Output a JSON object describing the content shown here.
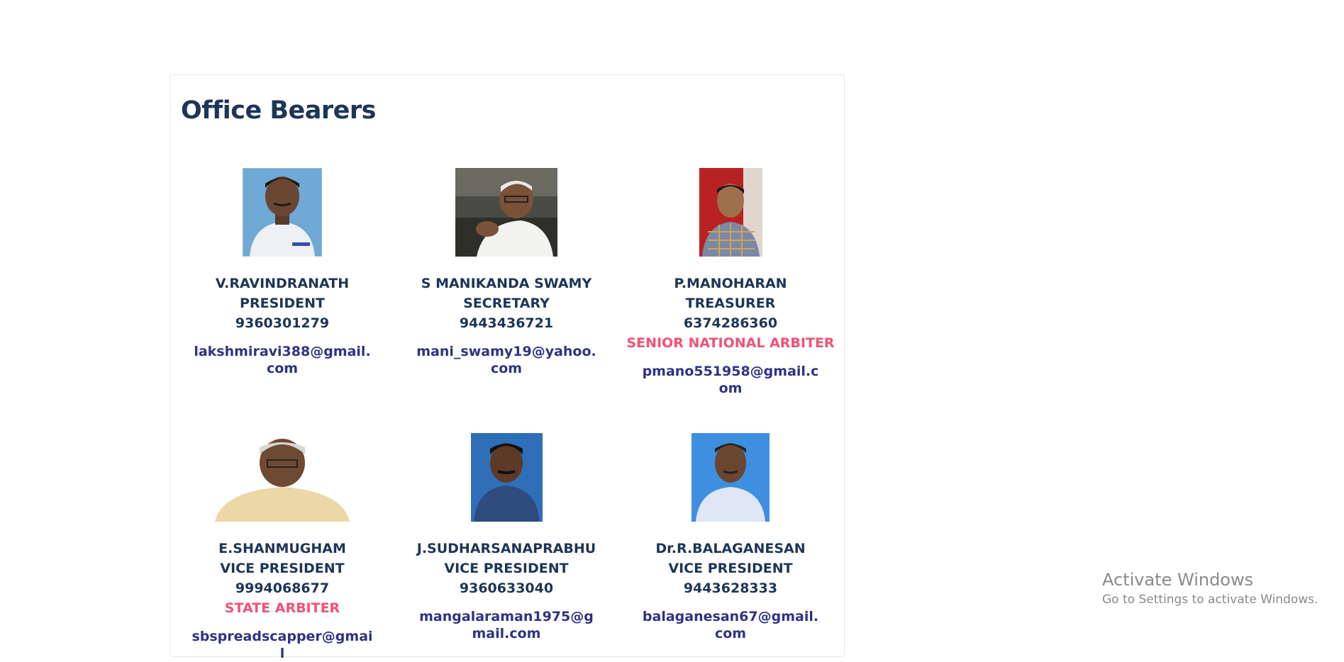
{
  "section": {
    "title": "Office Bearers"
  },
  "members": [
    {
      "name": "V.RAVINDRANATH",
      "role": "PRESIDENT",
      "phone": "9360301279",
      "title_badge": "",
      "email": "lakshmiravi388@gmail.com"
    },
    {
      "name": "S MANIKANDA SWAMY",
      "role": "SECRETARY",
      "phone": "9443436721",
      "title_badge": "",
      "email": "mani_swamy19@yahoo.com"
    },
    {
      "name": "P.MANOHARAN",
      "role": "TREASURER",
      "phone": "6374286360",
      "title_badge": "SENIOR NATIONAL ARBITER",
      "email": "pmano551958@gmail.com"
    },
    {
      "name": "E.SHANMUGHAM",
      "role": "VICE PRESIDENT",
      "phone": "9994068677",
      "title_badge": "STATE ARBITER",
      "email": "sbspreadscapper@gmail"
    },
    {
      "name": "J.SUDHARSANAPRABHU",
      "role": "VICE PRESIDENT",
      "phone": "9360633040",
      "title_badge": "",
      "email": "mangalaraman1975@gmail.com"
    },
    {
      "name": "Dr.R.BALAGANESAN",
      "role": "VICE PRESIDENT",
      "phone": "9443628333",
      "title_badge": "",
      "email": "balaganesan67@gmail.com"
    }
  ],
  "watermark": {
    "title": "Activate Windows",
    "subtitle": "Go to Settings to activate Windows."
  },
  "colors": {
    "heading": "#1d3557",
    "arbiter": "#f05275",
    "email": "#2e3383"
  }
}
